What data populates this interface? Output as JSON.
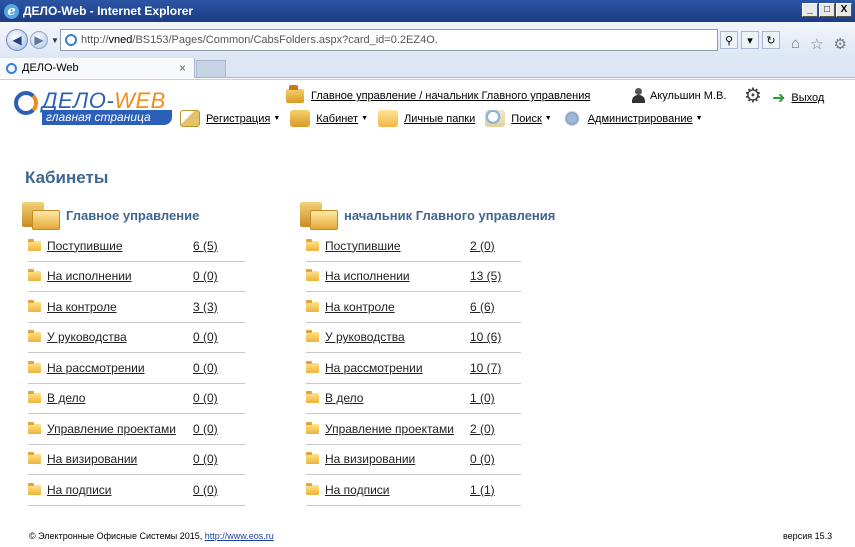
{
  "window": {
    "title": "ДЕЛО-Web - Internet Explorer",
    "controls": [
      "_",
      "□",
      "X"
    ]
  },
  "address": {
    "url_prefix": "http://",
    "url_host": "vned",
    "url_rest": "/BS153/Pages/Common/CabsFolders.aspx?card_id=0.2EZ4O."
  },
  "tab": {
    "label": "ДЕЛО-Web",
    "close": "×"
  },
  "header": {
    "logo_brand": "ДЕЛО-",
    "logo_brand_accent": "WEB",
    "logo_subtitle": "главная страница",
    "department_link": "Главное управление / начальник Главного управления",
    "user_name": "Акульшин М.В.",
    "logout_label": "Выход"
  },
  "menu": {
    "registration": "Регистрация",
    "cabinet": "Кабинет",
    "personal_folders": "Личные папки",
    "search": "Поиск",
    "administration": "Администрирование"
  },
  "page": {
    "title": "Кабинеты"
  },
  "cabinets": [
    {
      "title": "Главное управление",
      "folders": [
        {
          "name": "Поступившие",
          "count": "6  (5)"
        },
        {
          "name": "На исполнении",
          "count": "0  (0)"
        },
        {
          "name": "На контроле",
          "count": "3  (3)"
        },
        {
          "name": "У руководства",
          "count": "0  (0)"
        },
        {
          "name": "На рассмотрении",
          "count": "0  (0)"
        },
        {
          "name": "В дело",
          "count": "0  (0)"
        },
        {
          "name": "Управление проектами",
          "count": "0  (0)"
        },
        {
          "name": "На визировании",
          "count": "0  (0)"
        },
        {
          "name": "На подписи",
          "count": "0  (0)"
        }
      ]
    },
    {
      "title": "начальник Главного управления",
      "folders": [
        {
          "name": "Поступившие",
          "count": "2  (0)"
        },
        {
          "name": "На исполнении",
          "count": "13  (5)"
        },
        {
          "name": "На контроле",
          "count": "6  (6)"
        },
        {
          "name": "У руководства",
          "count": "10  (6)"
        },
        {
          "name": "На рассмотрении",
          "count": "10  (7)"
        },
        {
          "name": "В дело",
          "count": "1  (0)"
        },
        {
          "name": "Управление проектами",
          "count": "2  (0)"
        },
        {
          "name": "На визировании",
          "count": "0  (0)"
        },
        {
          "name": "На подписи",
          "count": "1  (1)"
        }
      ]
    }
  ],
  "footer": {
    "copyright": "© Электронные Офисные Системы 2015,",
    "link": "http://www.eos.ru",
    "version": "версия 15.3"
  }
}
